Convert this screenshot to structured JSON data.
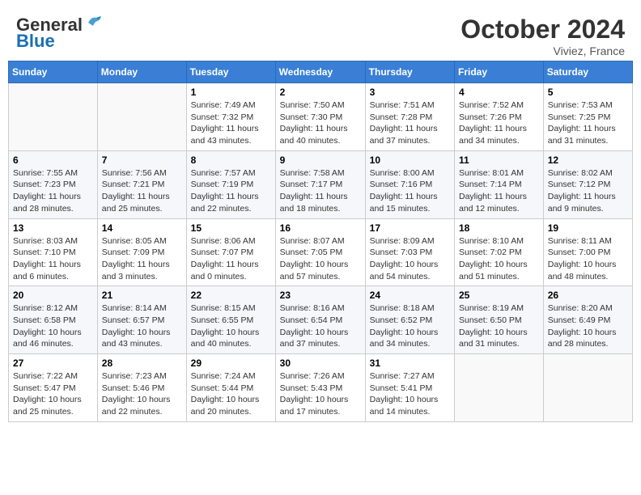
{
  "header": {
    "logo_general": "General",
    "logo_blue": "Blue",
    "month_title": "October 2024",
    "location": "Viviez, France"
  },
  "columns": [
    "Sunday",
    "Monday",
    "Tuesday",
    "Wednesday",
    "Thursday",
    "Friday",
    "Saturday"
  ],
  "weeks": [
    [
      {
        "day": "",
        "info": ""
      },
      {
        "day": "",
        "info": ""
      },
      {
        "day": "1",
        "info": "Sunrise: 7:49 AM\nSunset: 7:32 PM\nDaylight: 11 hours and 43 minutes."
      },
      {
        "day": "2",
        "info": "Sunrise: 7:50 AM\nSunset: 7:30 PM\nDaylight: 11 hours and 40 minutes."
      },
      {
        "day": "3",
        "info": "Sunrise: 7:51 AM\nSunset: 7:28 PM\nDaylight: 11 hours and 37 minutes."
      },
      {
        "day": "4",
        "info": "Sunrise: 7:52 AM\nSunset: 7:26 PM\nDaylight: 11 hours and 34 minutes."
      },
      {
        "day": "5",
        "info": "Sunrise: 7:53 AM\nSunset: 7:25 PM\nDaylight: 11 hours and 31 minutes."
      }
    ],
    [
      {
        "day": "6",
        "info": "Sunrise: 7:55 AM\nSunset: 7:23 PM\nDaylight: 11 hours and 28 minutes."
      },
      {
        "day": "7",
        "info": "Sunrise: 7:56 AM\nSunset: 7:21 PM\nDaylight: 11 hours and 25 minutes."
      },
      {
        "day": "8",
        "info": "Sunrise: 7:57 AM\nSunset: 7:19 PM\nDaylight: 11 hours and 22 minutes."
      },
      {
        "day": "9",
        "info": "Sunrise: 7:58 AM\nSunset: 7:17 PM\nDaylight: 11 hours and 18 minutes."
      },
      {
        "day": "10",
        "info": "Sunrise: 8:00 AM\nSunset: 7:16 PM\nDaylight: 11 hours and 15 minutes."
      },
      {
        "day": "11",
        "info": "Sunrise: 8:01 AM\nSunset: 7:14 PM\nDaylight: 11 hours and 12 minutes."
      },
      {
        "day": "12",
        "info": "Sunrise: 8:02 AM\nSunset: 7:12 PM\nDaylight: 11 hours and 9 minutes."
      }
    ],
    [
      {
        "day": "13",
        "info": "Sunrise: 8:03 AM\nSunset: 7:10 PM\nDaylight: 11 hours and 6 minutes."
      },
      {
        "day": "14",
        "info": "Sunrise: 8:05 AM\nSunset: 7:09 PM\nDaylight: 11 hours and 3 minutes."
      },
      {
        "day": "15",
        "info": "Sunrise: 8:06 AM\nSunset: 7:07 PM\nDaylight: 11 hours and 0 minutes."
      },
      {
        "day": "16",
        "info": "Sunrise: 8:07 AM\nSunset: 7:05 PM\nDaylight: 10 hours and 57 minutes."
      },
      {
        "day": "17",
        "info": "Sunrise: 8:09 AM\nSunset: 7:03 PM\nDaylight: 10 hours and 54 minutes."
      },
      {
        "day": "18",
        "info": "Sunrise: 8:10 AM\nSunset: 7:02 PM\nDaylight: 10 hours and 51 minutes."
      },
      {
        "day": "19",
        "info": "Sunrise: 8:11 AM\nSunset: 7:00 PM\nDaylight: 10 hours and 48 minutes."
      }
    ],
    [
      {
        "day": "20",
        "info": "Sunrise: 8:12 AM\nSunset: 6:58 PM\nDaylight: 10 hours and 46 minutes."
      },
      {
        "day": "21",
        "info": "Sunrise: 8:14 AM\nSunset: 6:57 PM\nDaylight: 10 hours and 43 minutes."
      },
      {
        "day": "22",
        "info": "Sunrise: 8:15 AM\nSunset: 6:55 PM\nDaylight: 10 hours and 40 minutes."
      },
      {
        "day": "23",
        "info": "Sunrise: 8:16 AM\nSunset: 6:54 PM\nDaylight: 10 hours and 37 minutes."
      },
      {
        "day": "24",
        "info": "Sunrise: 8:18 AM\nSunset: 6:52 PM\nDaylight: 10 hours and 34 minutes."
      },
      {
        "day": "25",
        "info": "Sunrise: 8:19 AM\nSunset: 6:50 PM\nDaylight: 10 hours and 31 minutes."
      },
      {
        "day": "26",
        "info": "Sunrise: 8:20 AM\nSunset: 6:49 PM\nDaylight: 10 hours and 28 minutes."
      }
    ],
    [
      {
        "day": "27",
        "info": "Sunrise: 7:22 AM\nSunset: 5:47 PM\nDaylight: 10 hours and 25 minutes."
      },
      {
        "day": "28",
        "info": "Sunrise: 7:23 AM\nSunset: 5:46 PM\nDaylight: 10 hours and 22 minutes."
      },
      {
        "day": "29",
        "info": "Sunrise: 7:24 AM\nSunset: 5:44 PM\nDaylight: 10 hours and 20 minutes."
      },
      {
        "day": "30",
        "info": "Sunrise: 7:26 AM\nSunset: 5:43 PM\nDaylight: 10 hours and 17 minutes."
      },
      {
        "day": "31",
        "info": "Sunrise: 7:27 AM\nSunset: 5:41 PM\nDaylight: 10 hours and 14 minutes."
      },
      {
        "day": "",
        "info": ""
      },
      {
        "day": "",
        "info": ""
      }
    ]
  ]
}
